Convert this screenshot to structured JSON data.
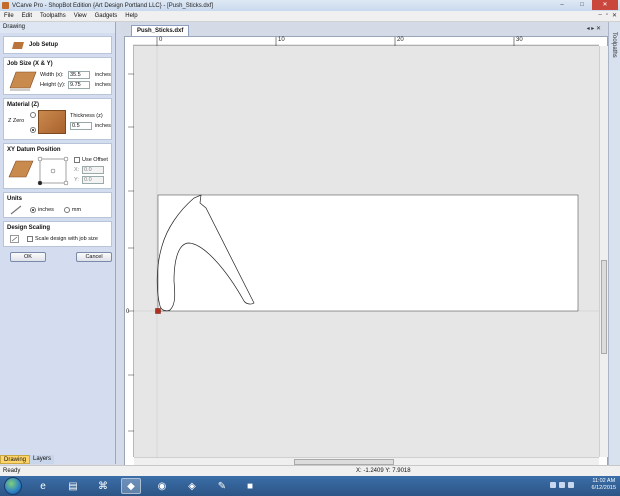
{
  "window": {
    "title": "VCarve Pro - ShopBot Edition {Art Design Portland LLC} - [Push_Sticks.dxf]",
    "buttons": {
      "minimize": "–",
      "maximize": "□",
      "close": "✕"
    }
  },
  "menu": [
    "File",
    "Edit",
    "Toolpaths",
    "View",
    "Gadgets",
    "Help"
  ],
  "mdi_buttons": [
    "–",
    "▫",
    "✕"
  ],
  "left_panel": {
    "header": "Drawing",
    "job_setup_label": "Job Setup",
    "job_size": {
      "title": "Job Size (X & Y)",
      "width_label": "Width (x):",
      "width_value": "35.5",
      "height_label": "Height (y):",
      "height_value": "9.75",
      "unit": "inches"
    },
    "material": {
      "title": "Material (Z)",
      "zzero_label": "Z Zero",
      "thickness_label": "Thickness (z)",
      "thickness_value": "0.5",
      "unit": "inches"
    },
    "xy_datum": {
      "title": "XY Datum Position",
      "use_offset_label": "Use Offset",
      "x_label": "X:",
      "x_value": "0.0",
      "y_label": "Y:",
      "y_value": "0.0"
    },
    "units": {
      "title": "Units",
      "inches": "inches",
      "mm": "mm"
    },
    "design_scaling": {
      "title": "Design Scaling",
      "scale_label": "Scale design with job size"
    },
    "ok_label": "OK",
    "cancel_label": "Cancel",
    "tabs": [
      "Drawing",
      "Layers"
    ]
  },
  "document": {
    "tab_label": "Push_Sticks.dxf",
    "nav": "◂ ▸ ✕",
    "ruler_top": [
      "0",
      "10",
      "20",
      "30"
    ],
    "ruler_left": [
      "0"
    ]
  },
  "tools_tab": "Toolpaths",
  "status": {
    "ready": "Ready",
    "coords": "X: -1.2409 Y: 7.9018"
  },
  "taskbar": {
    "time": "11:02 AM",
    "date": "6/12/2015"
  },
  "colors": {
    "accent": "#ffd56b",
    "taskbar": "#2c5586",
    "origin": "#b03020"
  }
}
